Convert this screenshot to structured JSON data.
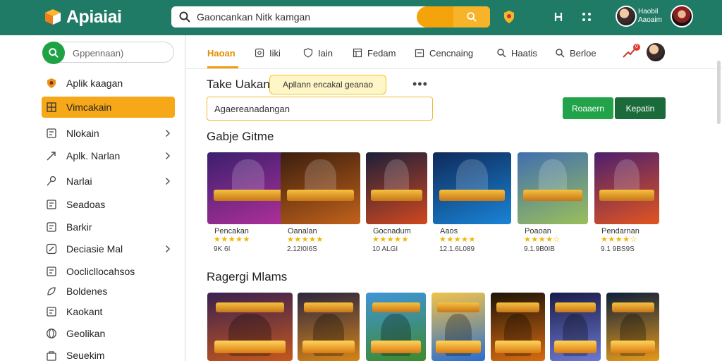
{
  "app": {
    "name": "Apiaiai"
  },
  "header": {
    "search_text": "Gaoncankan Nitk kamgan",
    "user_name_line1": "Haobil",
    "user_name_line2": "Aaoaim"
  },
  "sidebar": {
    "search_placeholder": "Gppennaan)",
    "items": [
      {
        "label": "Aplik kaagan",
        "icon": "shield-badge-icon",
        "chevron": false,
        "active": false
      },
      {
        "label": "Vimcakain",
        "icon": "grid-icon",
        "chevron": false,
        "active": true
      },
      {
        "label": "Nlokain",
        "icon": "square-grid-icon",
        "chevron": true,
        "active": false
      },
      {
        "label": "Aplk. Narlan",
        "icon": "arrow-pen-icon",
        "chevron": true,
        "active": false
      },
      {
        "label": "Narlai",
        "icon": "pin-icon",
        "chevron": true,
        "active": false
      },
      {
        "label": "Seadoas",
        "icon": "doc-icon",
        "chevron": false,
        "active": false
      },
      {
        "label": "Barkir",
        "icon": "card-icon",
        "chevron": false,
        "active": false
      },
      {
        "label": "Deciasie Mal",
        "icon": "edit-icon",
        "chevron": true,
        "active": false
      },
      {
        "label": "Ooclicllocahsos",
        "icon": "list-icon",
        "chevron": false,
        "active": false
      },
      {
        "label": "Boldenes",
        "icon": "leaf-icon",
        "chevron": false,
        "active": false
      },
      {
        "label": "Kaokant",
        "icon": "box-icon",
        "chevron": false,
        "active": false
      },
      {
        "label": "Geolikan",
        "icon": "globe-icon",
        "chevron": false,
        "active": false
      },
      {
        "label": "Seuekim",
        "icon": "bag-icon",
        "chevron": false,
        "active": false
      }
    ]
  },
  "tabs": [
    {
      "label": "Haoan",
      "icon": "",
      "active": true
    },
    {
      "label": "Iiki",
      "icon": "badge-icon",
      "active": false
    },
    {
      "label": "Iain",
      "icon": "shield-icon",
      "active": false
    },
    {
      "label": "Fedam",
      "icon": "table-icon",
      "active": false
    },
    {
      "label": "Cencnaing",
      "icon": "calendar-icon",
      "active": false
    },
    {
      "label": "Haatis",
      "icon": "search-icon",
      "active": false
    },
    {
      "label": "Berloe",
      "icon": "search-icon",
      "active": false
    }
  ],
  "notification_count": "0",
  "content": {
    "section1_title": "Take Uakan",
    "tooltip": "Apllann encakal geanao",
    "field_value": "Agaereanadangan",
    "btn_primary": "Roaaern",
    "btn_secondary": "Kepatin",
    "section2_title": "Gabje Gitme",
    "section3_title": "Ragergi Mlams"
  },
  "featured_games": [
    {
      "name": "Pencakan",
      "stars": "★★★★★",
      "count": "9K 6I",
      "colors": [
        "#3a1f6e",
        "#b0309a"
      ]
    },
    {
      "name": "Oanalan",
      "stars": "★★★★★",
      "count": "2.12I0I6S",
      "colors": [
        "#3b1e0e",
        "#c2621b"
      ]
    },
    {
      "name": "Gocnadum",
      "stars": "★★★★★",
      "count": "10 ALGI",
      "colors": [
        "#1c1f3a",
        "#d0481f"
      ]
    },
    {
      "name": "Aaos",
      "stars": "★★★★★",
      "count": "12.1.6L089",
      "colors": [
        "#0e2a5a",
        "#1a84d6"
      ]
    },
    {
      "name": "Poaoan",
      "stars": "★★★★☆",
      "count": "9.1.9B0IB",
      "colors": [
        "#3f6fb0",
        "#9bbf5a"
      ]
    },
    {
      "name": "Pendarnan",
      "stars": "★★★★☆",
      "count": "9.1 9BS9S",
      "colors": [
        "#4c1f6e",
        "#e2551f"
      ]
    }
  ],
  "recommended_games": [
    {
      "colors": [
        "#3a2050",
        "#c4571d"
      ]
    },
    {
      "colors": [
        "#2b2640",
        "#d48419"
      ]
    },
    {
      "colors": [
        "#3f94d8",
        "#3e8a2f"
      ]
    },
    {
      "colors": [
        "#f0c24a",
        "#2a6fd0"
      ]
    },
    {
      "colors": [
        "#1e1408",
        "#d76b11"
      ]
    },
    {
      "colors": [
        "#1a1d4a",
        "#6c78d0"
      ]
    },
    {
      "colors": [
        "#0d1f3a",
        "#e59a1c"
      ]
    }
  ]
}
